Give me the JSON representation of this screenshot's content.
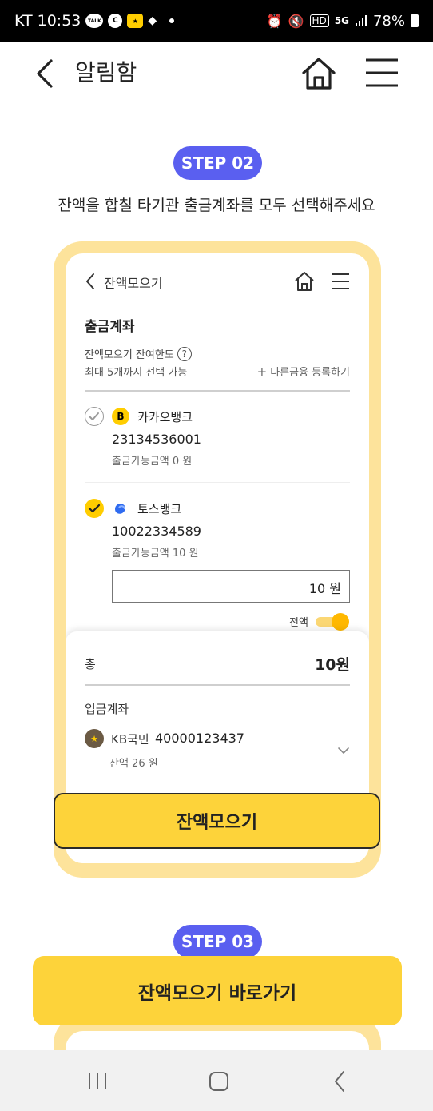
{
  "status_bar": {
    "carrier_time": "KT 10:53",
    "icons": [
      "talk-icon",
      "c-icon",
      "kb-star-icon",
      "pill-icon",
      "alarm-icon",
      "mute-icon",
      "hd-icon",
      "5g-icon",
      "signal-icon",
      "battery-icon"
    ],
    "talk_text": "TALK",
    "c_text": "C",
    "hd_text": "HD",
    "net_text": "5G",
    "battery": "78%"
  },
  "header": {
    "title": "알림함"
  },
  "step2": {
    "label": "STEP 02",
    "instruction": "잔액을 합칠 타기관 출금계좌를 모두 선택해주세요"
  },
  "mock_screen": {
    "title": "잔액모으기",
    "section_title": "출금계좌",
    "limit_label": "잔액모으기 잔여한도",
    "max_text": "최대 5개까지 선택 가능",
    "add_link": "다른금융 등록하기",
    "accounts": [
      {
        "bank": "카카오뱅크",
        "logo_text": "B",
        "number": "23134536001",
        "available": "출금가능금액 0 원",
        "checked": false
      },
      {
        "bank": "토스뱅크",
        "number": "10022334589",
        "available": "출금가능금액 10 원",
        "checked": true
      }
    ],
    "amount_value": "10 원",
    "all_label": "전액",
    "toggle_on": true,
    "summary": {
      "total_label": "총",
      "total_value": "10원",
      "deposit_label": "입금계좌",
      "deposit_bank": "KB국민",
      "deposit_number": "40000123437",
      "deposit_balance": "잔액 26 원"
    },
    "collect_button": "잔액모으기"
  },
  "step3": {
    "label": "STEP 03"
  },
  "shortcut_button": "잔액모으기 바로가기",
  "colors": {
    "step_pill": "#5a5ff0",
    "accent_yellow": "#fdd33a",
    "frame_yellow": "#fde39b"
  }
}
